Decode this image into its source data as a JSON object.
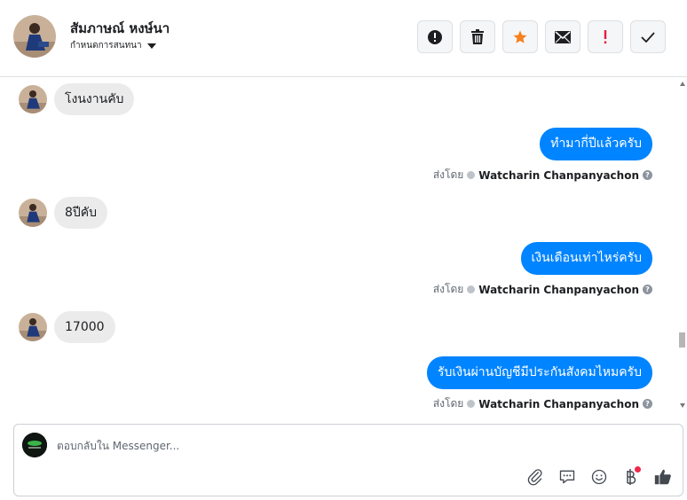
{
  "header": {
    "contact_name": "สัมภาษณ์ หงษ์นา",
    "subtitle": "กำหนดการสนทนา",
    "actions": [
      {
        "icon": "alert-circle-icon",
        "color": "#1c1e21"
      },
      {
        "icon": "trash-icon",
        "color": "#1c1e21"
      },
      {
        "icon": "star-icon",
        "color": "#f5821f"
      },
      {
        "icon": "envelope-icon",
        "color": "#1c1e21"
      },
      {
        "icon": "exclamation-icon",
        "color": "#e41e3f"
      },
      {
        "icon": "check-icon",
        "color": "#1c1e21"
      }
    ]
  },
  "messages": [
    {
      "direction": "in",
      "text": "โงนงานคับ"
    },
    {
      "direction": "out",
      "text": "ทำมากี่ปีแล้วครับ",
      "sent_by_label": "ส่งโดย",
      "sender": "Watcharin Chanpanyachon"
    },
    {
      "direction": "in",
      "text": "8ปีคับ"
    },
    {
      "direction": "out",
      "text": "เงินเดือนเท่าไหร่ครับ",
      "sent_by_label": "ส่งโดย",
      "sender": "Watcharin Chanpanyachon"
    },
    {
      "direction": "in",
      "text": "17000"
    },
    {
      "direction": "out",
      "text": "รับเงินผ่านบัญชีมีประกันสังคมไหมครับ",
      "sent_by_label": "ส่งโดย",
      "sender": "Watcharin Chanpanyachon"
    }
  ],
  "composer": {
    "placeholder": "ตอบกลับใน Messenger...",
    "tools": [
      "paperclip-icon",
      "chat-bubble-icon",
      "smiley-icon",
      "baht-icon",
      "thumbs-up-icon"
    ]
  },
  "colors": {
    "accent": "#0084ff",
    "incoming_bubble": "#ebebeb",
    "star": "#f5821f",
    "urgent": "#e41e3f",
    "notification": "#f02849"
  }
}
